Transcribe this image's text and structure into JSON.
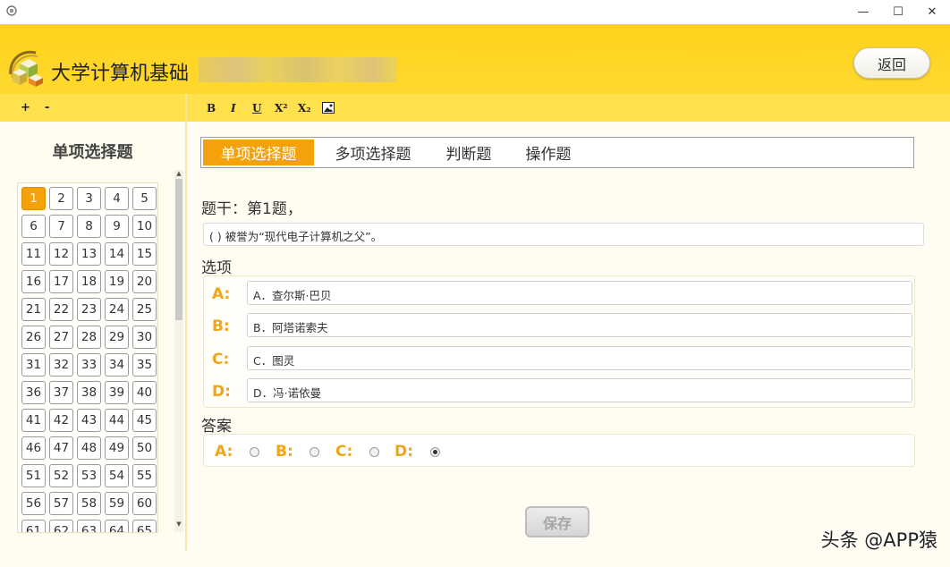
{
  "window": {
    "minimize_glyph": "—",
    "maximize_glyph": "☐",
    "close_glyph": "✕"
  },
  "header": {
    "title": "大学计算机基础",
    "back_label": "返回"
  },
  "toolbar": {
    "zoom_in": "+",
    "zoom_out": "-",
    "bold": "B",
    "italic": "I",
    "underline": "U",
    "superscript": "X²",
    "subscript": "X₂",
    "image_icon": "image-icon"
  },
  "sidebar": {
    "title": "单项选择题",
    "questions": [
      "1",
      "2",
      "3",
      "4",
      "5",
      "6",
      "7",
      "8",
      "9",
      "10",
      "11",
      "12",
      "13",
      "14",
      "15",
      "16",
      "17",
      "18",
      "19",
      "20",
      "21",
      "22",
      "23",
      "24",
      "25",
      "26",
      "27",
      "28",
      "29",
      "30",
      "31",
      "32",
      "33",
      "34",
      "35",
      "36",
      "37",
      "38",
      "39",
      "40",
      "41",
      "42",
      "43",
      "44",
      "45",
      "46",
      "47",
      "48",
      "49",
      "50",
      "51",
      "52",
      "53",
      "54",
      "55",
      "56",
      "57",
      "58",
      "59",
      "60",
      "61",
      "62",
      "63",
      "64",
      "65"
    ],
    "active_question": "1",
    "scroll_up": "▲",
    "scroll_down": "▼"
  },
  "tabs": [
    "单项选择题",
    "多项选择题",
    "判断题",
    "操作题"
  ],
  "active_tab": 0,
  "question": {
    "stem_label": "题干：第1题，",
    "stem_text": "( ) 被誉为“现代电子计算机之父”。",
    "options_label": "选项",
    "options": [
      {
        "letter": "A:",
        "text": "A．查尔斯·巴贝"
      },
      {
        "letter": "B:",
        "text": "B．阿塔诺索夫"
      },
      {
        "letter": "C:",
        "text": "C．图灵"
      },
      {
        "letter": "D:",
        "text": "D．冯·诺依曼"
      }
    ],
    "answer_label": "答案",
    "answers": [
      "A:",
      "B:",
      "C:",
      "D:"
    ],
    "selected_answer": "D:"
  },
  "save_label": "保存",
  "watermark": "头条 @APP猿",
  "colors": {
    "accent": "#f4a20c",
    "header": "#ffd21c",
    "toolbar": "#ffe14d"
  }
}
